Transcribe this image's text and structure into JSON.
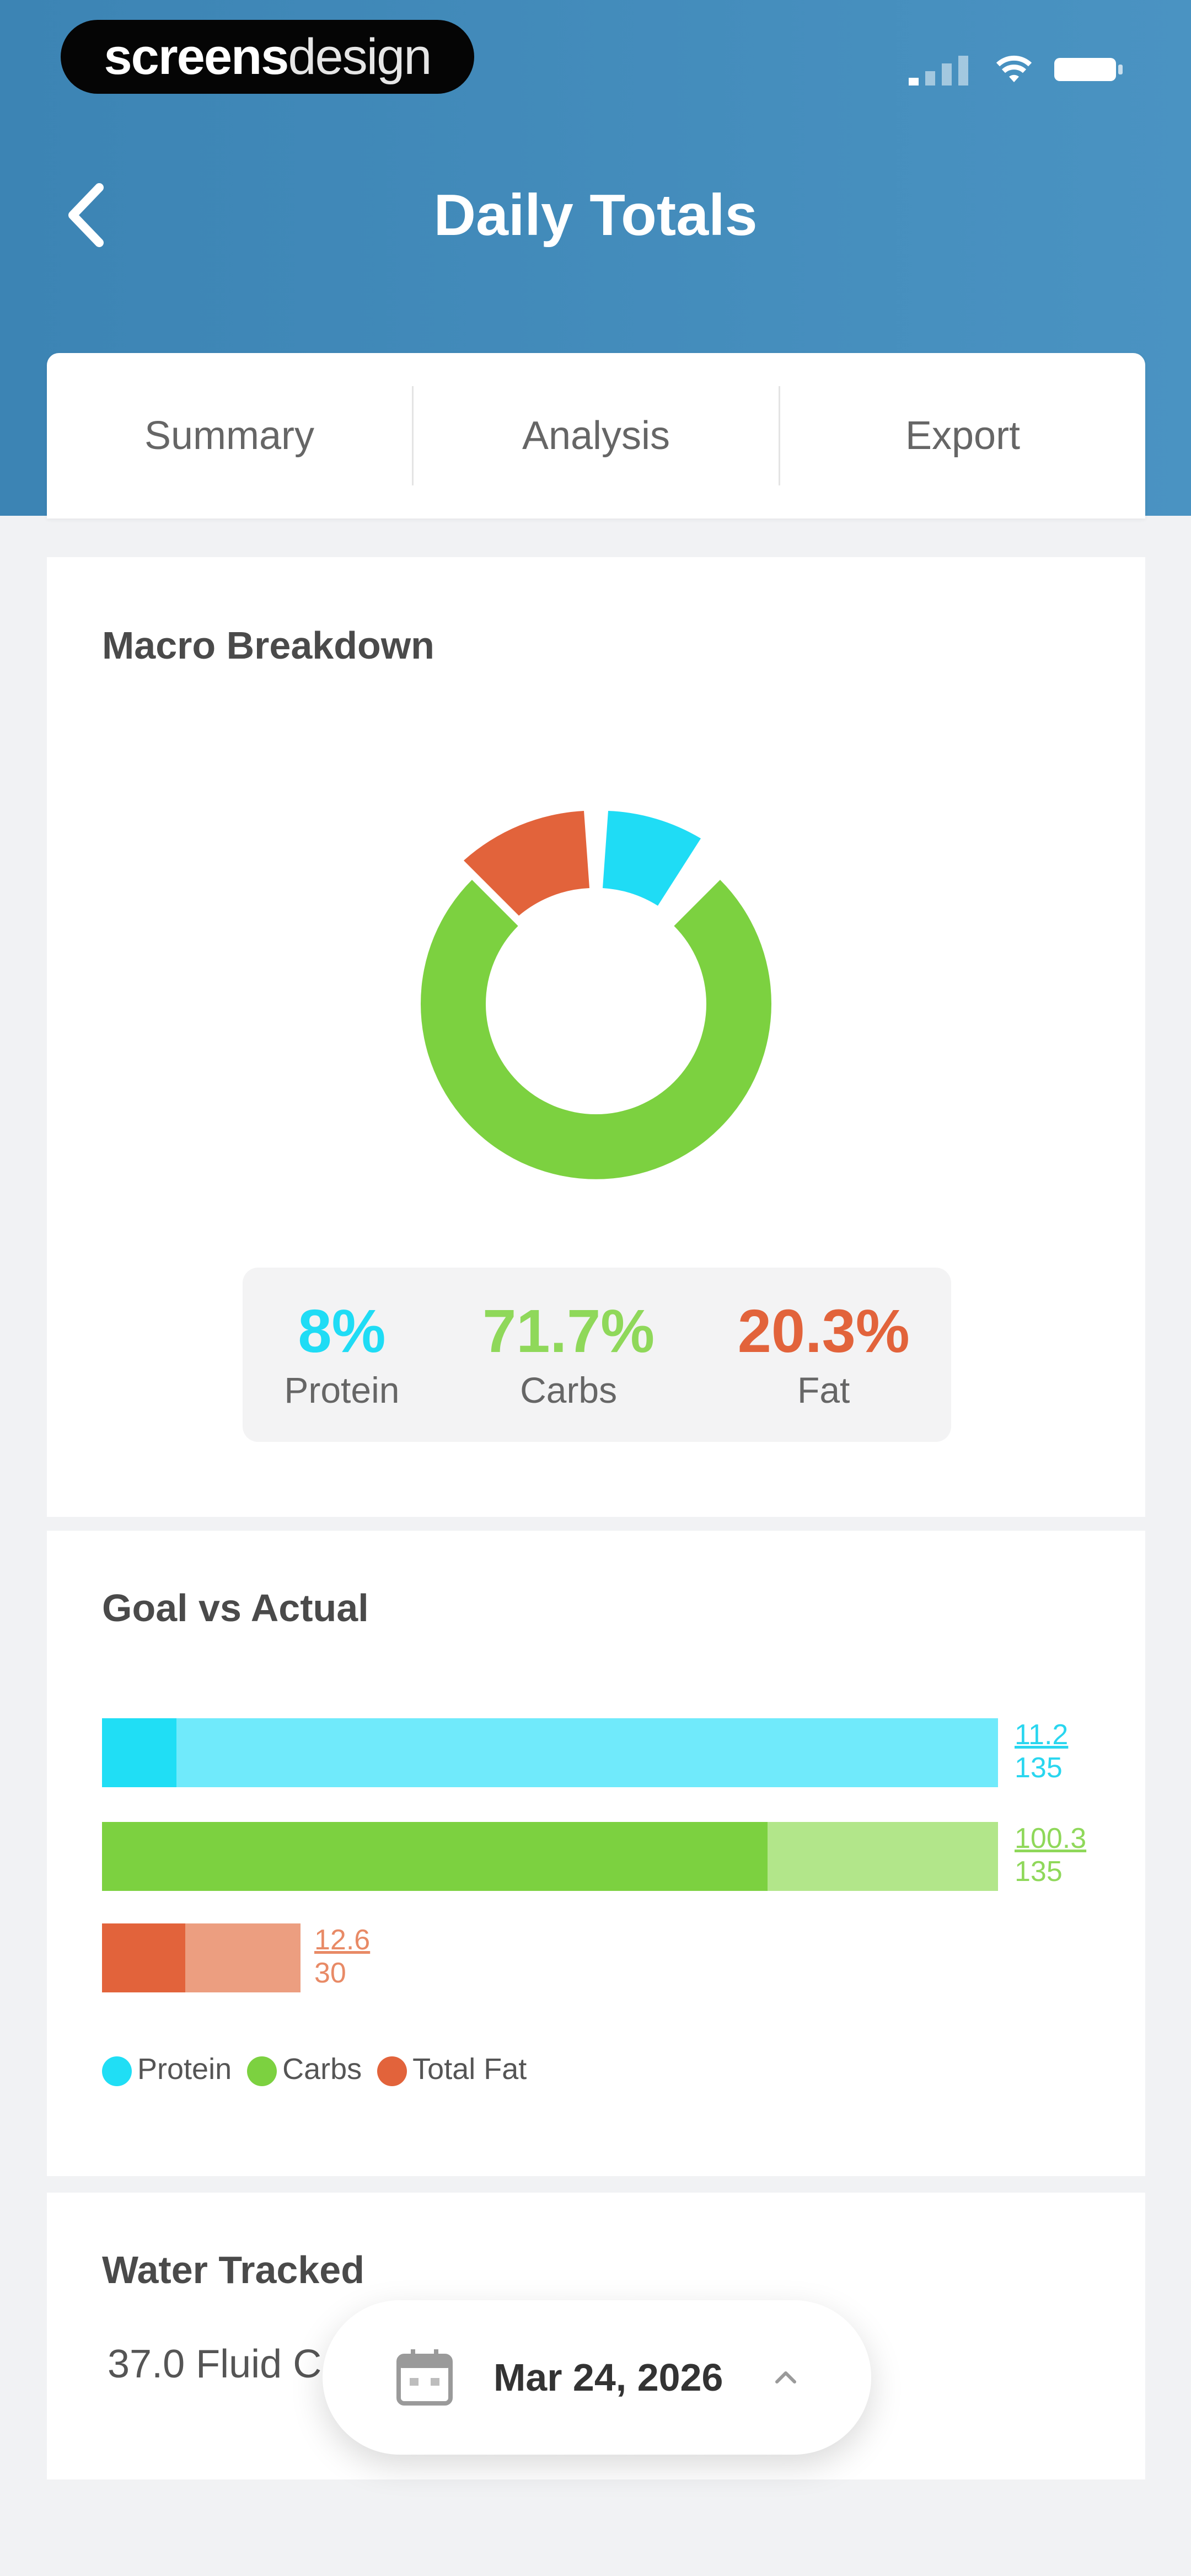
{
  "brand": {
    "logo_bold": "screens",
    "logo_light": "design"
  },
  "header": {
    "title": "Daily Totals"
  },
  "tabs": [
    {
      "label": "Summary"
    },
    {
      "label": "Analysis"
    },
    {
      "label": "Export"
    }
  ],
  "macro": {
    "title": "Macro Breakdown",
    "protein": {
      "pct": "8%",
      "label": "Protein",
      "color": "#1fdcf5"
    },
    "carbs": {
      "pct": "71.7%",
      "label": "Carbs",
      "color": "#7cd140"
    },
    "fat": {
      "pct": "20.3%",
      "label": "Fat",
      "color": "#e2633b"
    }
  },
  "goal": {
    "title": "Goal vs Actual",
    "rows": [
      {
        "name": "protein",
        "actual": "11.2",
        "goal": "135",
        "fill": 0.083,
        "dark": "#20def5",
        "light": "#70eafb"
      },
      {
        "name": "carbs",
        "actual": "100.3",
        "goal": "135",
        "fill": 0.743,
        "dark": "#7cd140",
        "light": "#b2e68a"
      },
      {
        "name": "fat",
        "actual": "12.6",
        "goal": "30",
        "fill": 0.42,
        "dark": "#e2633b",
        "light": "#ec9e80"
      }
    ],
    "legend": [
      {
        "label": "Protein"
      },
      {
        "label": "Carbs"
      },
      {
        "label": "Total Fat"
      }
    ]
  },
  "water": {
    "title": "Water Tracked",
    "value": "37.0 Fluid C"
  },
  "date_picker": {
    "label": "Mar 24, 2026"
  }
}
